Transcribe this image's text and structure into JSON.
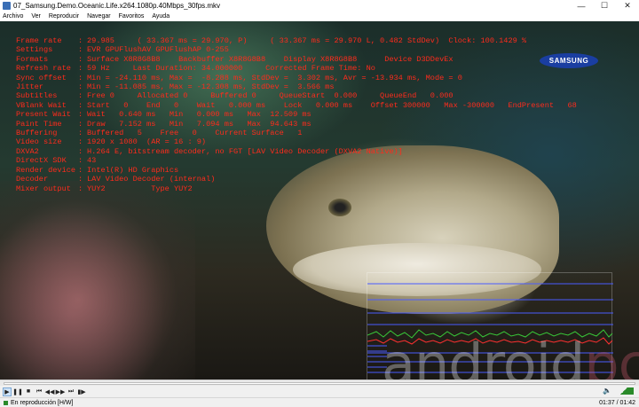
{
  "window": {
    "title": "07_Samsung.Demo.Oceanic.Life.x264.1080p.40Mbps_30fps.mkv",
    "minimize": "—",
    "maximize": "☐",
    "close": "✕"
  },
  "menu": [
    "Archivo",
    "Ver",
    "Reproducir",
    "Navegar",
    "Favoritos",
    "Ayuda"
  ],
  "logo": "SAMSUNG",
  "stats": [
    {
      "label": "Frame rate",
      "value": "29.985     ( 33.367 ms = 29.970, P)     ( 33.367 ms = 29.970 L, 0.482 StdDev)  Clock: 100.1429 %"
    },
    {
      "label": "Settings",
      "value": "EVR GPUFlushAV GPUFlushAP 0-255"
    },
    {
      "label": "Formats",
      "value": "Surface X8R8G8B8    Backbuffer X8R8G8B8    Display X8R8G8B8      Device D3DDevEx"
    },
    {
      "label": "Refresh rate",
      "value": "59 Hz     Last Duration: 34.000000     Corrected Frame Time: No"
    },
    {
      "label": "Sync offset",
      "value": "Min = -24.110 ms, Max =  -8.288 ms, StdDev =  3.302 ms, Avr = -13.934 ms, Mode = 0"
    },
    {
      "label": "Jitter",
      "value": "Min = -11.085 ms, Max = -12.308 ms, StdDev =  3.566 ms"
    },
    {
      "label": "Subtitles",
      "value": "Free 0     Allocated 0     Buffered 0     QueueStart  0.000     QueueEnd   0.000"
    },
    {
      "label": "VBlank Wait",
      "value": "Start   0    End   0    Wait   0.000 ms    Lock   0.000 ms    Offset 300000   Max -300000   EndPresent   68"
    },
    {
      "label": "Present Wait",
      "value": "Wait   0.640 ms   Min   0.000 ms   Max  12.509 ms"
    },
    {
      "label": "Paint Time",
      "value": "Draw   7.152 ms   Min   7.094 ms   Max  94.643 ms"
    },
    {
      "label": "Buffering",
      "value": "Buffered   5    Free   0    Current Surface   1"
    },
    {
      "label": "Video size",
      "value": "1920 x 1080  (AR = 16 : 9)"
    },
    {
      "label": "DXVA2",
      "value": "H.264 E, bitstream decoder, no FGT [LAV Video Decoder (DXVA2 Native)]"
    },
    {
      "label": "DirectX SDK",
      "value": "43"
    },
    {
      "label": "Render device",
      "value": "Intel(R) HD Graphics"
    },
    {
      "label": "Decoder",
      "value": "LAV Video Decoder (internal)"
    },
    {
      "label": "Mixer output",
      "value": "YUY2          Type YUY2"
    }
  ],
  "watermark": {
    "main": "android",
    "accent": "pc"
  },
  "controls": {
    "play": "▶",
    "pause": "❚❚",
    "stop": "■",
    "prev": "⏮",
    "rew": "◀◀",
    "fwd": "▶▶",
    "next": "⏭",
    "frame": "▮▶",
    "volume_icon": "🔈"
  },
  "status": {
    "text": "En reproducción [H/W]",
    "time": "01:37 / 01:42"
  },
  "colors": {
    "osd_text": "#ff2b1c",
    "graph_blue": "#4a5cff",
    "graph_green": "#38c838",
    "graph_red": "#ff3030"
  }
}
